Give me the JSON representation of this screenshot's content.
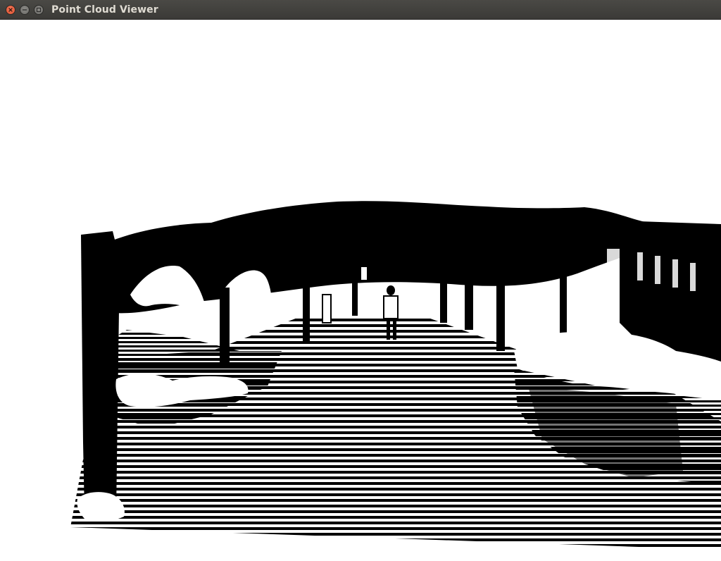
{
  "window": {
    "title": "Point Cloud Viewer",
    "controls": [
      {
        "name": "close",
        "icon": "close-icon"
      },
      {
        "name": "minimize",
        "icon": "minimize-icon"
      },
      {
        "name": "maximize",
        "icon": "maximize-icon"
      }
    ],
    "colors": {
      "titlebar": "#3c3b37",
      "title_text": "#dfdbd2",
      "close_button": "#e95420",
      "viewport_background": "#ffffff",
      "points": "#000000"
    }
  },
  "viewport": {
    "content": "point-cloud-rendering"
  }
}
